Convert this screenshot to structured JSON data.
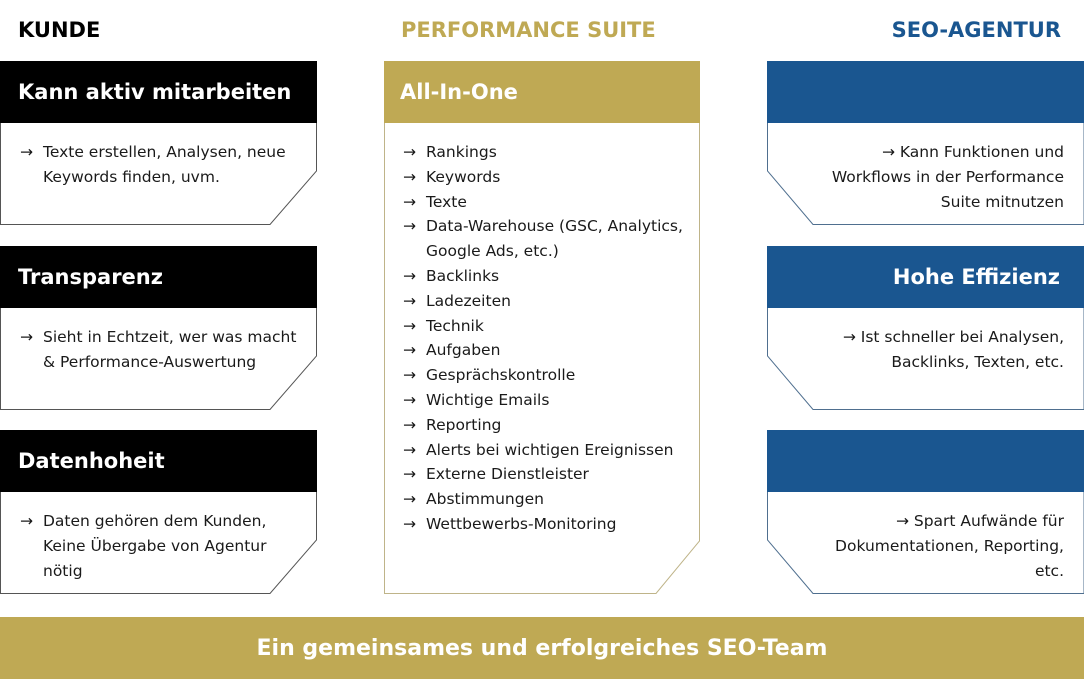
{
  "colors": {
    "kunde": "#000000",
    "suite": "#bfa954",
    "agentur": "#1a5690",
    "footer": "#bfa954"
  },
  "columns": {
    "kunde": {
      "title": "KUNDE",
      "cards": [
        {
          "heading": "Kann aktiv mitarbeiten",
          "arrow": "→",
          "text": "Texte erstellen, Analysen, neue Keywords finden, uvm."
        },
        {
          "heading": "Transparenz",
          "arrow": "→",
          "text": "Sieht in Echtzeit, wer was macht & Performance-Auswertung"
        },
        {
          "heading": "Datenhoheit",
          "arrow": "→",
          "text": "Daten gehören dem Kunden, Keine Übergabe von Agentur nötig"
        }
      ]
    },
    "suite": {
      "title": "PERFORMANCE SUITE",
      "card": {
        "heading": "All-In-One",
        "arrow": "→",
        "items": [
          "Rankings",
          "Keywords",
          "Texte",
          "Data-Warehouse (GSC, Analytics, Google Ads, etc.)",
          "Backlinks",
          "Ladezeiten",
          "Technik",
          "Aufgaben",
          "Gesprächskontrolle",
          "Wichtige Emails",
          "Reporting",
          "Alerts bei wichtigen Ereignissen",
          "Externe Dienstleister",
          "Abstimmungen",
          "Wettbewerbs-Monitoring"
        ]
      }
    },
    "agentur": {
      "title": "SEO-AGENTUR",
      "cards": [
        {
          "heading": "",
          "text": "→ Kann Funktionen und Workflows in der Performance Suite mitnutzen"
        },
        {
          "heading": "Hohe Effizienz",
          "text": "→ Ist schneller bei Analysen, Backlinks, Texten, etc."
        },
        {
          "heading": "",
          "text": "→ Spart Aufwände für Dokumentationen, Reporting, etc."
        }
      ]
    }
  },
  "footer": {
    "text": "Ein gemeinsames und erfolgreiches SEO-Team"
  }
}
